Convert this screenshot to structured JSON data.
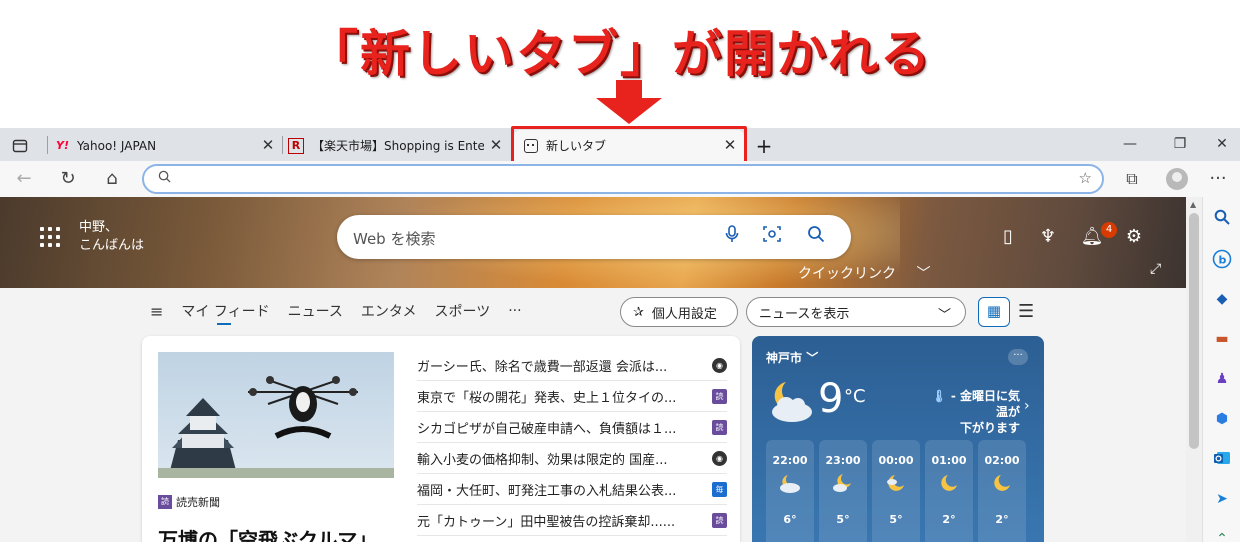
{
  "annotation": {
    "title": "「新しいタブ」が開かれる",
    "title_color": "#e8231d",
    "highlight_color": "#e8231d"
  },
  "tabs": [
    {
      "favicon": "yahoo-favicon",
      "favicon_text": "Y!",
      "label": "Yahoo! JAPAN"
    },
    {
      "favicon": "rakuten-favicon",
      "favicon_text": "R",
      "label": "【楽天市場】Shopping is Entertainm"
    },
    {
      "favicon": "newtab-favicon",
      "label": "新しいタブ",
      "active": true
    }
  ],
  "new_tab_button": "+",
  "window_controls": {
    "minimize": "—",
    "restore": "❐",
    "close": "✕"
  },
  "toolbar": {
    "back": "←",
    "refresh": "↻",
    "home": "⌂",
    "address_placeholder": "",
    "search_icon": "search-icon",
    "more": "···"
  },
  "newtab": {
    "greeting_line1": "中野、",
    "greeting_line2": "こんばんは",
    "search_placeholder": "Web を検索",
    "quick_links": "クイックリンク",
    "notification_count": "4",
    "feed_nav": [
      "マイ フィード",
      "ニュース",
      "エンタメ",
      "スポーツ",
      "···"
    ],
    "personalize_label": "個人用設定",
    "news_select": "ニュースを表示"
  },
  "news": {
    "publisher": "読売新聞",
    "publisher_badge": "読",
    "headline": "万博の「空飛ぶクルマ」、",
    "stories": [
      {
        "title": "ガーシー氏、除名で歳費一部返還 会派は...",
        "source": "tbs",
        "badge": "◉"
      },
      {
        "title": "東京で「桜の開花」発表、史上１位タイの...",
        "source": "yomi",
        "badge": "読"
      },
      {
        "title": "シカゴピザが自己破産申請へ、負債額は１...",
        "source": "yomi",
        "badge": "読"
      },
      {
        "title": "輸入小麦の価格抑制、効果は限定的 国産...",
        "source": "tbs",
        "badge": "◉"
      },
      {
        "title": "福岡・大任町、町発注工事の入札結果公表...",
        "source": "mai",
        "badge": "毎"
      },
      {
        "title": "元「カトゥーン」田中聖被告の控訴棄却......",
        "source": "yomi",
        "badge": "読"
      }
    ]
  },
  "weather": {
    "city": "神戸市",
    "city_chevron": "﹀",
    "more": "···",
    "temp": "9",
    "unit": "°C",
    "alert_line1": "- 金曜日に気温が",
    "alert_line2": "下がります",
    "hourly": [
      {
        "time": "22:00",
        "icon": "cloudy-moon-icon",
        "temp": "6°"
      },
      {
        "time": "23:00",
        "icon": "partly-cloudy-moon-icon",
        "temp": "5°"
      },
      {
        "time": "00:00",
        "icon": "moon-cloud-icon",
        "temp": "5°"
      },
      {
        "time": "01:00",
        "icon": "moon-icon",
        "temp": "2°"
      },
      {
        "time": "02:00",
        "icon": "moon-icon",
        "temp": "2°"
      }
    ]
  },
  "colors": {
    "accent": "#0f6cbd",
    "weather_bg": "#2c5f93"
  }
}
